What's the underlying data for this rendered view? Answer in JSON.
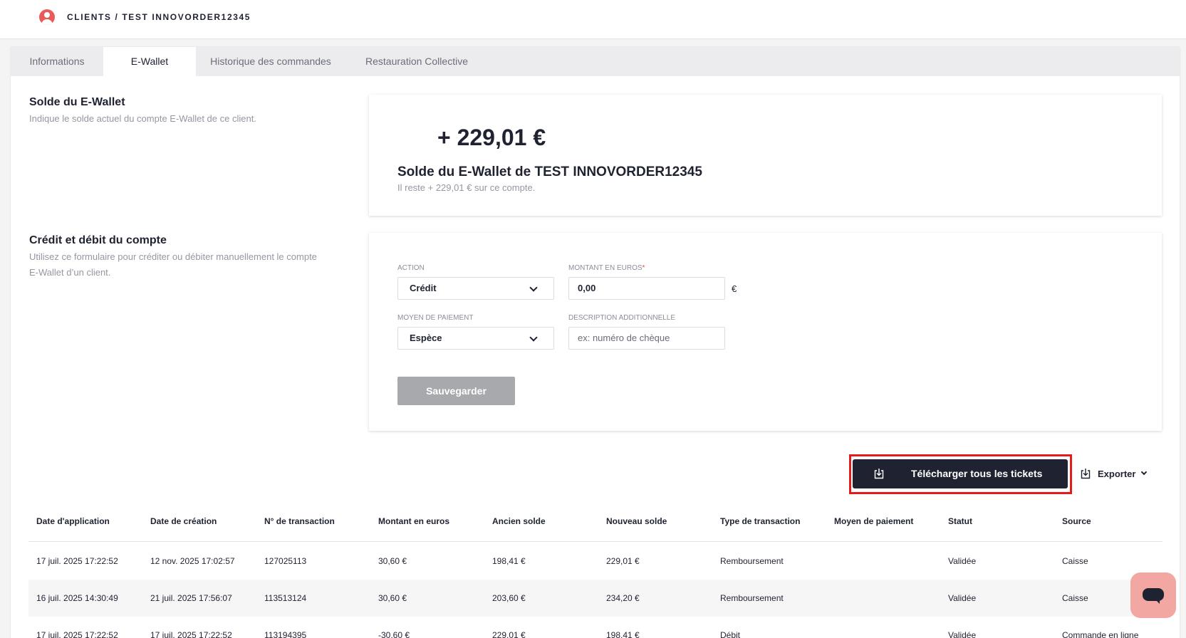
{
  "header": {
    "breadcrumb": "CLIENTS / TEST INNOVORDER12345",
    "user_icon": "user-circle-icon"
  },
  "tabs": [
    {
      "label": "Informations",
      "active": false
    },
    {
      "label": "E-Wallet",
      "active": true
    },
    {
      "label": "Historique des commandes",
      "active": false
    },
    {
      "label": "Restauration Collective",
      "active": false
    }
  ],
  "balance_section": {
    "title": "Solde du E-Wallet",
    "description": "Indique le solde actuel du compte E-Wallet de ce client.",
    "amount": "+ 229,01 €",
    "card_title": "Solde du E-Wallet de TEST INNOVORDER12345",
    "card_subtitle": "Il reste + 229,01 € sur ce compte."
  },
  "credit_section": {
    "title": "Crédit et débit du compte",
    "description_line1": "Utilisez ce formulaire pour créditer ou débiter manuellement le compte",
    "description_line2": "E-Wallet d’un client.",
    "action_label": "ACTION",
    "action_value": "Crédit",
    "amount_label": "MONTANT EN EUROS",
    "amount_required": "*",
    "amount_value": "0,00",
    "currency": "€",
    "payment_label": "MOYEN DE PAIEMENT",
    "payment_value": "Espèce",
    "description_label": "DESCRIPTION ADDITIONNELLE",
    "description_placeholder": "ex: numéro de chèque",
    "save_label": "Sauvegarder"
  },
  "toolbar": {
    "download_all_label": "Télécharger tous les tickets",
    "export_label": "Exporter"
  },
  "table": {
    "headers": [
      "Date d'application",
      "Date de création",
      "N° de transaction",
      "Montant en euros",
      "Ancien solde",
      "Nouveau solde",
      "Type de transaction",
      "Moyen de paiement",
      "Statut",
      "Source"
    ],
    "rows": [
      [
        "17 juil. 2025 17:22:52",
        "12 nov. 2025 17:02:57",
        "127025113",
        "30,60 €",
        "198,41 €",
        "229,01 €",
        "Remboursement",
        "",
        "Validée",
        "Caisse"
      ],
      [
        "16 juil. 2025 14:30:49",
        "21 juil. 2025 17:56:07",
        "113513124",
        "30,60 €",
        "203,60 €",
        "234,20 €",
        "Remboursement",
        "",
        "Validée",
        "Caisse"
      ],
      [
        "17 juil. 2025 17:22:52",
        "17 juil. 2025 17:22:52",
        "113194395",
        "-30,60 €",
        "229,01 €",
        "198,41 €",
        "Débit",
        "",
        "Validée",
        "Commande en ligne"
      ]
    ]
  },
  "colors": {
    "accent": "#1f2230",
    "highlight_frame": "#e21b1b",
    "chat_button": "#f2a7a2",
    "user_icon": "#ea5a5a"
  }
}
